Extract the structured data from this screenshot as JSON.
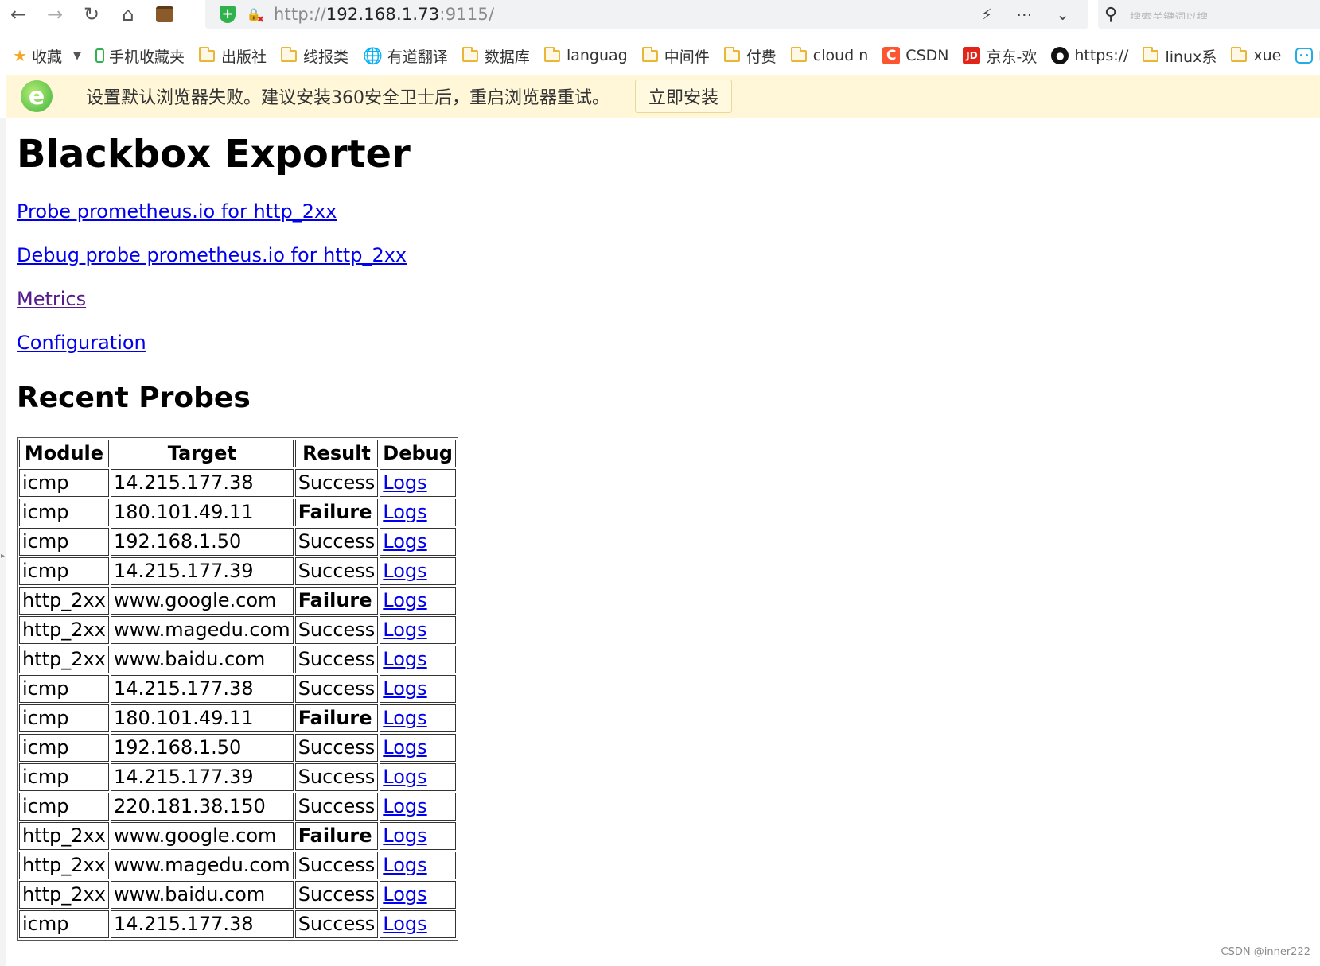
{
  "browser": {
    "url_prefix": "http://",
    "url_host": "192.168.1.73",
    "url_suffix": ":9115/",
    "search_placeholder": "搜索关键词以搜"
  },
  "bookmarks": [
    {
      "label": "收藏",
      "icon": "star-icon"
    },
    {
      "label": "手机收藏夹",
      "icon": "phone-icon"
    },
    {
      "label": "出版社",
      "icon": "folder-icon"
    },
    {
      "label": "线报类",
      "icon": "folder-icon"
    },
    {
      "label": "有道翻译",
      "icon": "globe-icon"
    },
    {
      "label": "数据库",
      "icon": "folder-icon"
    },
    {
      "label": "languag",
      "icon": "folder-icon"
    },
    {
      "label": "中间件",
      "icon": "folder-icon"
    },
    {
      "label": "付费",
      "icon": "folder-icon"
    },
    {
      "label": "cloud n",
      "icon": "folder-icon"
    },
    {
      "label": "CSDN",
      "icon": "csdn-icon"
    },
    {
      "label": "京东-欢",
      "icon": "jd-icon"
    },
    {
      "label": "https://",
      "icon": "github-icon"
    },
    {
      "label": "linux系",
      "icon": "folder-icon"
    },
    {
      "label": "xue",
      "icon": "folder-icon"
    },
    {
      "label": "哔哩",
      "icon": "bilibili-icon"
    }
  ],
  "notification": {
    "message": "设置默认浏览器失败。建议安装360安全卫士后，重启浏览器重试。",
    "button": "立即安装"
  },
  "page": {
    "title": "Blackbox Exporter",
    "links": {
      "probe": "Probe prometheus.io for http_2xx",
      "debug": "Debug probe prometheus.io for http_2xx",
      "metrics": "Metrics",
      "configuration": "Configuration"
    },
    "recent_title": "Recent Probes"
  },
  "table": {
    "headers": [
      "Module",
      "Target",
      "Result",
      "Debug"
    ],
    "rows": [
      {
        "module": "icmp",
        "target": "14.215.177.38",
        "result": "Success",
        "debug": "Logs"
      },
      {
        "module": "icmp",
        "target": "180.101.49.11",
        "result": "Failure",
        "debug": "Logs"
      },
      {
        "module": "icmp",
        "target": "192.168.1.50",
        "result": "Success",
        "debug": "Logs"
      },
      {
        "module": "icmp",
        "target": "14.215.177.39",
        "result": "Success",
        "debug": "Logs"
      },
      {
        "module": "http_2xx",
        "target": "www.google.com",
        "result": "Failure",
        "debug": "Logs"
      },
      {
        "module": "http_2xx",
        "target": "www.magedu.com",
        "result": "Success",
        "debug": "Logs"
      },
      {
        "module": "http_2xx",
        "target": "www.baidu.com",
        "result": "Success",
        "debug": "Logs"
      },
      {
        "module": "icmp",
        "target": "14.215.177.38",
        "result": "Success",
        "debug": "Logs"
      },
      {
        "module": "icmp",
        "target": "180.101.49.11",
        "result": "Failure",
        "debug": "Logs"
      },
      {
        "module": "icmp",
        "target": "192.168.1.50",
        "result": "Success",
        "debug": "Logs"
      },
      {
        "module": "icmp",
        "target": "14.215.177.39",
        "result": "Success",
        "debug": "Logs"
      },
      {
        "module": "icmp",
        "target": "220.181.38.150",
        "result": "Success",
        "debug": "Logs"
      },
      {
        "module": "http_2xx",
        "target": "www.google.com",
        "result": "Failure",
        "debug": "Logs"
      },
      {
        "module": "http_2xx",
        "target": "www.magedu.com",
        "result": "Success",
        "debug": "Logs"
      },
      {
        "module": "http_2xx",
        "target": "www.baidu.com",
        "result": "Success",
        "debug": "Logs"
      },
      {
        "module": "icmp",
        "target": "14.215.177.38",
        "result": "Success",
        "debug": "Logs"
      }
    ]
  },
  "watermark": "CSDN @inner222"
}
